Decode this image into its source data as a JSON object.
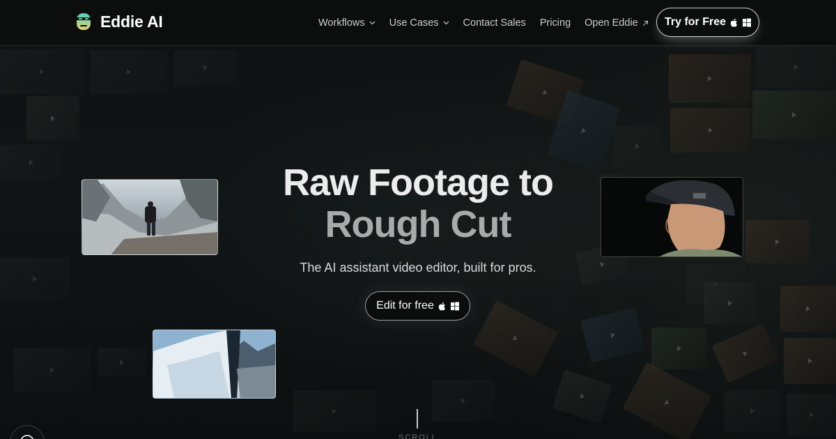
{
  "brand": {
    "name": "Eddie AI",
    "logo_icon": "eddie-logo-icon"
  },
  "nav": {
    "items": [
      {
        "label": "Workflows",
        "icon": "chevron-down-icon"
      },
      {
        "label": "Use Cases",
        "icon": "chevron-down-icon"
      },
      {
        "label": "Contact Sales"
      },
      {
        "label": "Pricing"
      },
      {
        "label": "Open Eddie",
        "icon": "arrow-up-right-icon"
      }
    ],
    "cta_label": "Try for Free",
    "cta_icons": [
      "apple-icon",
      "windows-icon"
    ]
  },
  "hero": {
    "title_line1": "Raw Footage to",
    "title_line2": "Rough Cut",
    "subtitle": "The AI assistant video editor, built for pros.",
    "button_label": "Edit for free",
    "button_icons": [
      "apple-icon",
      "windows-icon"
    ]
  },
  "scroll": {
    "label": "SCROLL"
  },
  "colors": {
    "background": "#0b0d0d",
    "text": "#ffffff",
    "muted_title": "#a9abaa",
    "border": "#cfd3d2"
  }
}
